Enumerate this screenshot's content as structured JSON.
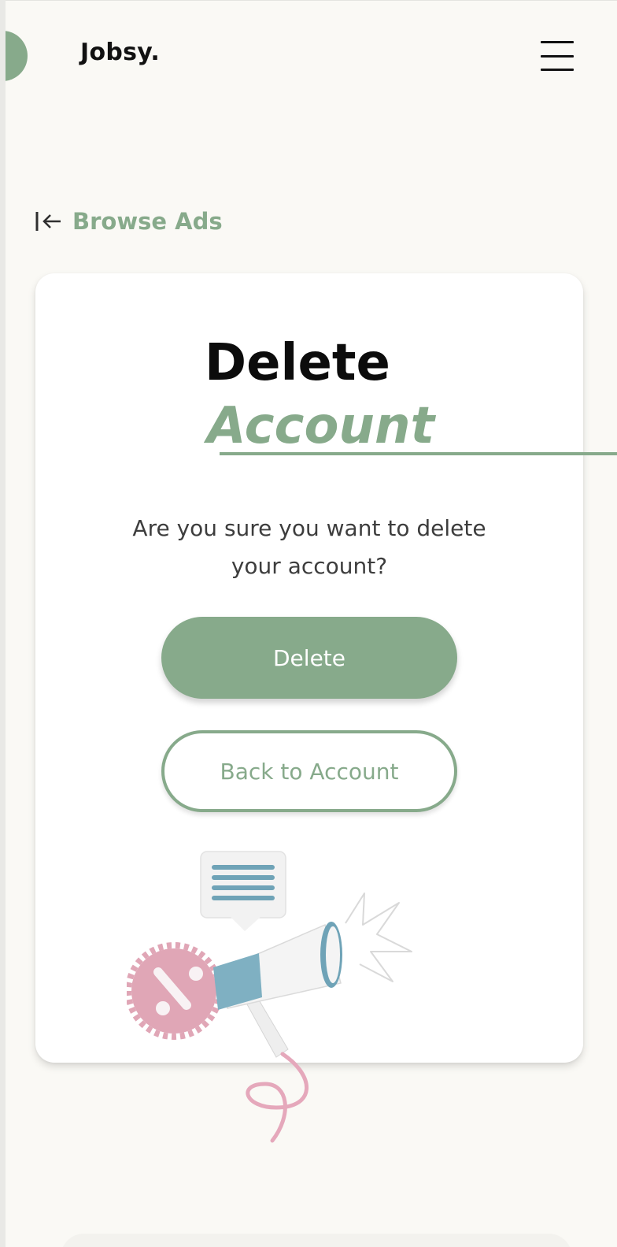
{
  "header": {
    "logo": "Jobsy.",
    "menu_icon": "hamburger-menu-icon"
  },
  "nav": {
    "back_label": "Browse Ads",
    "back_icon": "arrow-left-to-bar-icon"
  },
  "dialog": {
    "title_line1": "Delete",
    "title_line2": "Account",
    "question": "Are you sure you want to delete your account?",
    "delete_button": "Delete",
    "back_button": "Back to Account",
    "illustration": "megaphone-icon"
  },
  "colors": {
    "accent": "#87aa8b",
    "background": "#faf9f5",
    "card": "#ffffff",
    "text": "#0c0c0c",
    "pink": "#e0a6b6",
    "blue": "#6fa3b7"
  }
}
